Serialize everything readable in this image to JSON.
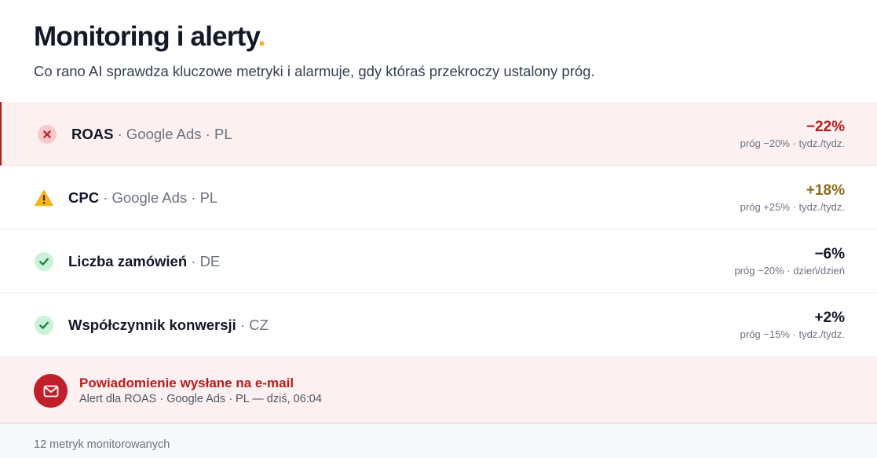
{
  "header": {
    "title": "Monitoring i alerty",
    "title_dot": ".",
    "subtitle": "Co rano AI sprawdza kluczowe metryki i alarmuje, gdy któraś przekroczy ustalony próg."
  },
  "colors": {
    "accent_dot": "#f5b41c",
    "alert_red": "#b91c1c",
    "warning_amber": "#8a6d1a",
    "ok_green": "#16a34a",
    "alert_background": "#fdf0f0"
  },
  "metrics": [
    {
      "status": "alert",
      "icon": "x-circle-icon",
      "name": "ROAS",
      "context": " · Google Ads · PL",
      "value": "−22%",
      "threshold": "próg −20% · tydz./tydz."
    },
    {
      "status": "warning",
      "icon": "warning-triangle-icon",
      "name": "CPC",
      "context": " · Google Ads · PL",
      "value": "+18%",
      "threshold": "próg +25% · tydz./tydz."
    },
    {
      "status": "ok",
      "icon": "check-circle-icon",
      "name": "Liczba zamówień",
      "context": " · DE",
      "value": "−6%",
      "threshold": "próg −20% · dzień/dzień"
    },
    {
      "status": "ok",
      "icon": "check-circle-icon",
      "name": "Współczynnik konwersji",
      "context": " · CZ",
      "value": "+2%",
      "threshold": "próg −15% · tydz./tydz."
    }
  ],
  "notification": {
    "icon": "mail-icon",
    "title": "Powiadomienie wysłane na e-mail",
    "description": "Alert dla ROAS · Google Ads · PL — dziś, 06:04"
  },
  "footer": {
    "text": "12 metryk monitorowanych"
  }
}
